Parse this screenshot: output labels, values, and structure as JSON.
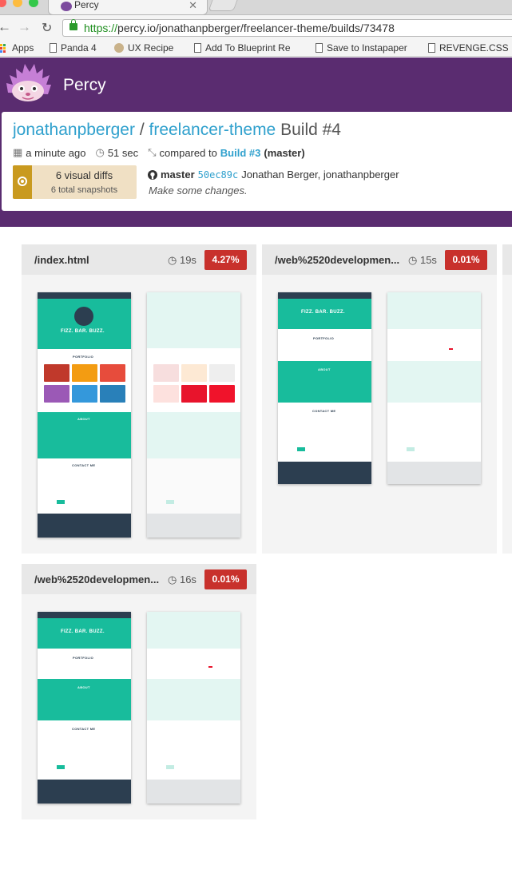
{
  "browser": {
    "tab_title": "Percy",
    "url_https": "https://",
    "url_rest": "percy.io/jonathanpberger/freelancer-theme/builds/73478",
    "bookmarks": [
      "Apps",
      "Panda 4",
      "UX Recipe",
      "Add To Blueprint Re",
      "Save to Instapaper",
      "REVENGE.CSS"
    ]
  },
  "app": {
    "brand": "Percy",
    "breadcrumb": {
      "owner": "jonathanpberger",
      "separator": "/",
      "repo": "freelancer-theme",
      "build": "Build #4"
    },
    "meta": {
      "time": "a minute ago",
      "duration": "51 sec",
      "compared_prefix": "compared to",
      "compared_build": "Build #3",
      "compared_branch": "(master)"
    },
    "diffs": {
      "visual": "6 visual diffs",
      "total": "6 total snapshots"
    },
    "commit": {
      "branch": "master",
      "hash": "50ec89c",
      "author": "Jonathan Berger, jonathanpberger",
      "message": "Make some changes."
    },
    "colors": {
      "header": "#5a2c70",
      "link": "#2fa0cd",
      "diff_badge": "#c8312c",
      "accent_teal": "#18bc9c"
    }
  },
  "snapshots": [
    {
      "name": "/index.html",
      "time": "19s",
      "diff": "4.27%"
    },
    {
      "name": "/web%2520developmen...",
      "time": "15s",
      "diff": "0.01%"
    },
    {
      "name": "/web%2520developmen...",
      "time": "16s",
      "diff": "0.01%"
    }
  ],
  "thumb": {
    "brand": "FIZZ. BAR. BUZZ.",
    "portfolio": "PORTFOLIO",
    "about": "ABOUT",
    "contact": "CONTACT ME"
  }
}
